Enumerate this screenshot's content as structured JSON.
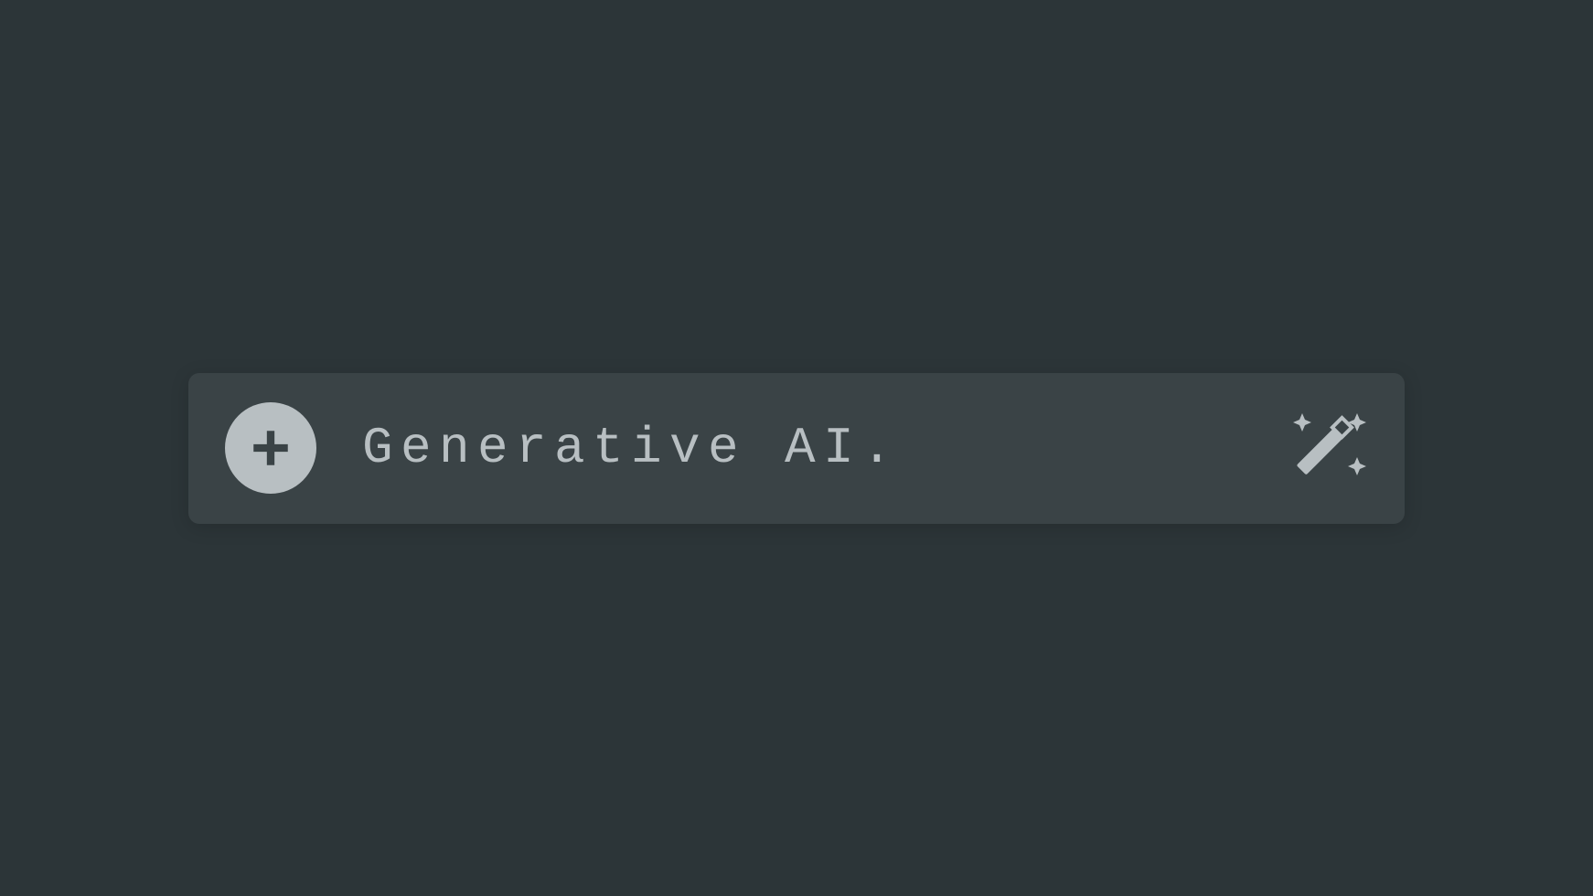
{
  "input_bar": {
    "placeholder": "Generative AI.",
    "add_icon": "plus",
    "magic_icon": "magic-wand-sparkles"
  }
}
